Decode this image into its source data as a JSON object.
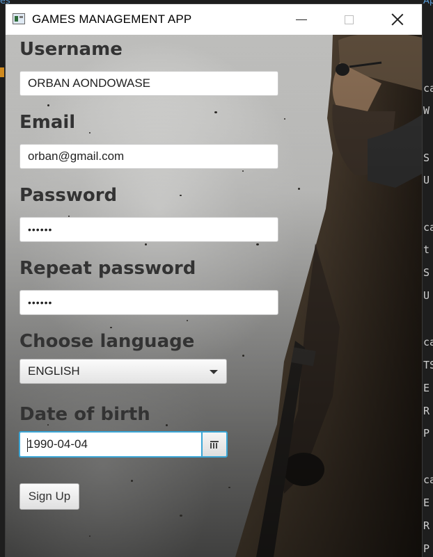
{
  "window": {
    "title": "GAMES MANAGEMENT APP"
  },
  "background_editor": {
    "right_fragments": [
      "ca",
      "W",
      "S",
      "U",
      "ca",
      "t",
      "S",
      "U",
      "ca",
      "TS",
      "E",
      "R",
      "P",
      "ca",
      "E",
      "R",
      "P"
    ],
    "top_fragment": "es",
    "top_right_fragment": "Ap"
  },
  "form": {
    "username": {
      "label": "Username",
      "value": "ORBAN AONDOWASE"
    },
    "email": {
      "label": "Email",
      "value": "orban@gmail.com"
    },
    "password": {
      "label": "Password",
      "value": "••••••"
    },
    "repeat_password": {
      "label": "Repeat password",
      "value": "••••••"
    },
    "language": {
      "label": "Choose language",
      "selected": "ENGLISH"
    },
    "date_of_birth": {
      "label": "Date of birth",
      "value": "1990-04-04"
    },
    "signup_label": "Sign Up"
  },
  "icons": {
    "app": "app-window-icon",
    "minimize": "minimize-icon",
    "maximize": "maximize-icon",
    "close": "close-icon",
    "dropdown": "chevron-down-icon",
    "calendar": "calendar-icon"
  },
  "colors": {
    "focus_border": "#3aa6d6",
    "label_text": "#333333"
  }
}
